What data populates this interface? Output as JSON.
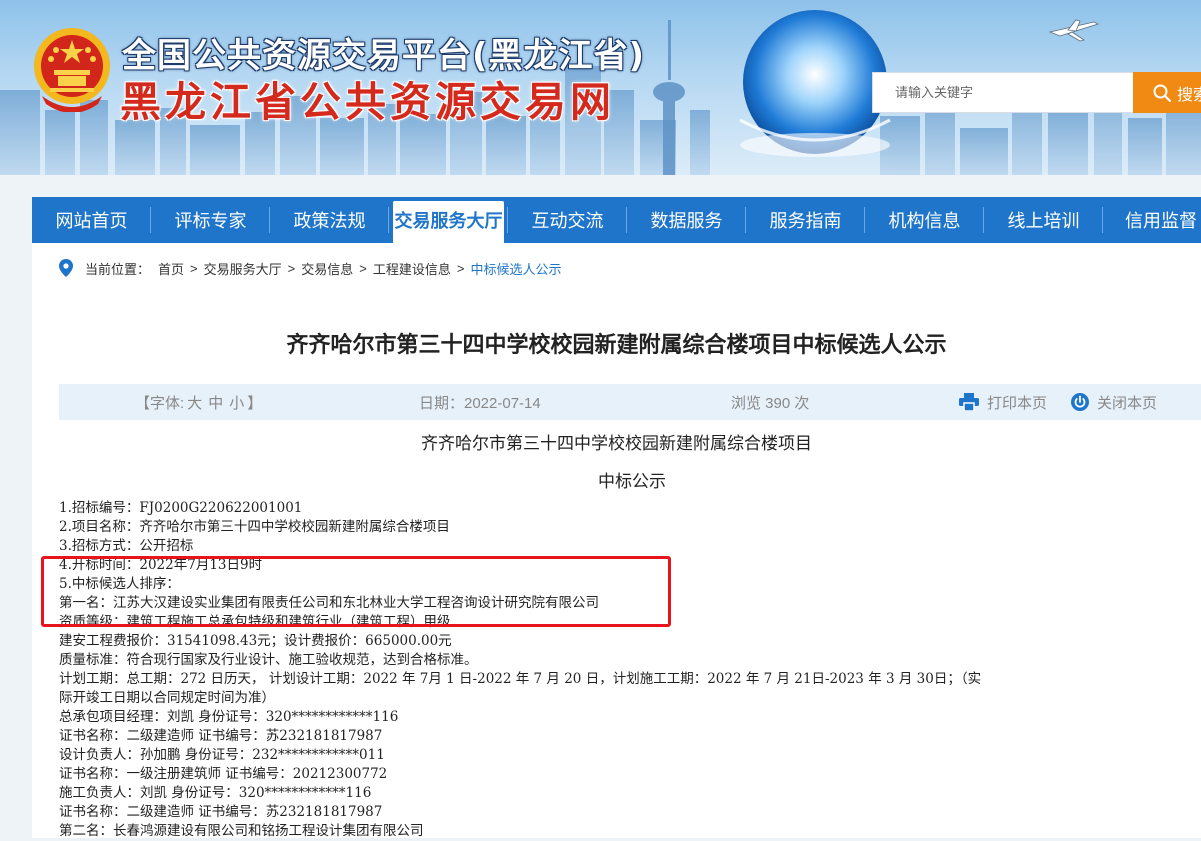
{
  "header": {
    "title_line1": "全国公共资源交易平台(黑龙江省)",
    "title_line2": "黑龙江省公共资源交易网",
    "search": {
      "placeholder": "请输入关键字",
      "button_label": "搜索"
    }
  },
  "nav": {
    "items": [
      {
        "label": "网站首页"
      },
      {
        "label": "评标专家"
      },
      {
        "label": "政策法规"
      },
      {
        "label": "交易服务大厅",
        "active": true
      },
      {
        "label": "互动交流"
      },
      {
        "label": "数据服务"
      },
      {
        "label": "服务指南"
      },
      {
        "label": "机构信息"
      },
      {
        "label": "线上培训"
      },
      {
        "label": "信用监督"
      }
    ]
  },
  "breadcrumb": {
    "prefix": "当前位置：",
    "items": [
      "首页",
      "交易服务大厅",
      "交易信息",
      "工程建设信息"
    ],
    "current": "中标候选人公示",
    "separator": ">"
  },
  "page_title": "齐齐哈尔市第三十四中学校校园新建附属综合楼项目中标候选人公示",
  "meta": {
    "font_label_open": "【字体:",
    "font_large": "大",
    "font_medium": "中",
    "font_small": "小",
    "font_label_close": "】",
    "date": "日期：2022-07-14",
    "views": "浏览 390 次",
    "print_label": "打印本页",
    "close_label": "关闭本页"
  },
  "document": {
    "title": "齐齐哈尔市第三十四中学校校园新建附属综合楼项目",
    "subtitle": "中标公示",
    "lines": [
      "1.招标编号：FJ0200G220622001001",
      "2.项目名称：齐齐哈尔市第三十四中学校校园新建附属综合楼项目",
      "3.招标方式：公开招标",
      "4.开标时间：2022年7月13日9时",
      "5.中标候选人排序：",
      "第一名：江苏大汉建设实业集团有限责任公司和东北林业大学工程咨询设计研究院有限公司",
      "资质等级：建筑工程施工总承包特级和建筑行业（建筑工程）甲级",
      "建安工程费报价：31541098.43元；设计费报价：665000.00元",
      "质量标准：符合现行国家及行业设计、施工验收规范，达到合格标准。",
      "计划工期：总工期：272  日历天， 计划设计工期：2022 年 7月 1  日-2022 年 7  月 20  日，计划施工工期：2022 年 7  月 21日-2023 年 3 月 30日；（实",
      "际开竣工日期以合同规定时间为准）",
      "总承包项目经理：刘凯          身份证号：320************116",
      "证书名称：二级建造师            证书编号：苏232181817987",
      "设计负责人：孙加鹏            身份证号：232************011",
      "证书名称：一级注册建筑师        证书编号：20212300772",
      "施工负责人：刘凯              身份证号：320************116",
      "证书名称：二级建造师           证书编号：苏232181817987",
      "第二名：长春鸿源建设有限公司和铭扬工程设计集团有限公司"
    ]
  }
}
